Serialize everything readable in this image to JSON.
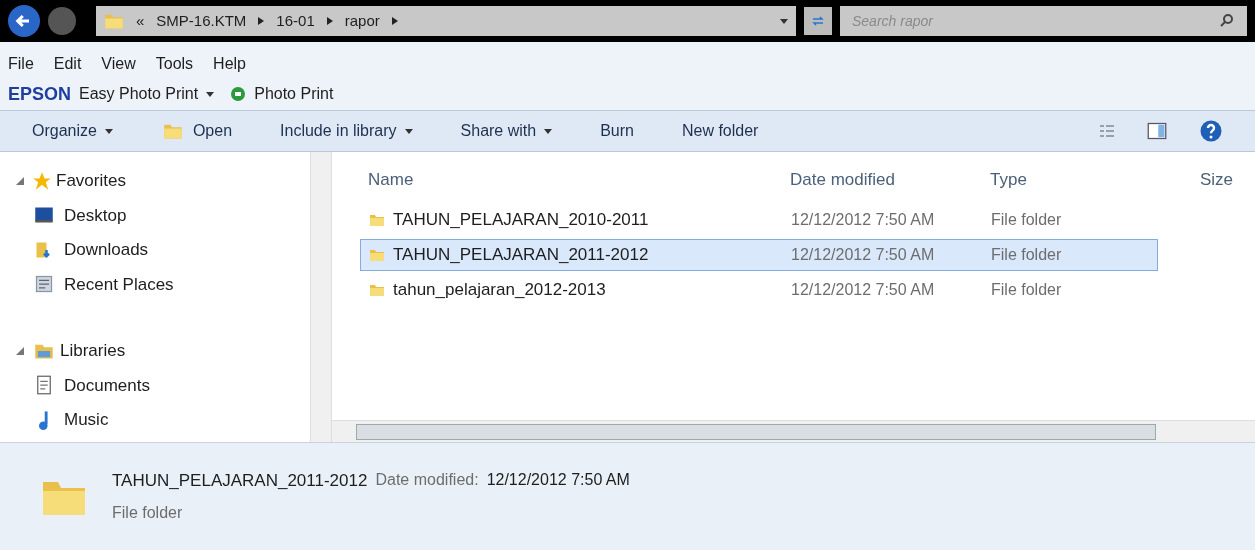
{
  "address_bar": {
    "crumbs": [
      "«",
      "SMP-16.KTM",
      "16-01",
      "rapor"
    ],
    "search_placeholder": "Search rapor"
  },
  "menu": [
    "File",
    "Edit",
    "View",
    "Tools",
    "Help"
  ],
  "epson_bar": {
    "brand": "EPSON",
    "app": "Easy Photo Print",
    "action": "Photo Print"
  },
  "toolbar": [
    {
      "label": "Organize",
      "kind": "dropdown"
    },
    {
      "label": "Open",
      "kind": "open"
    },
    {
      "label": "Include in library",
      "kind": "dropdown"
    },
    {
      "label": "Share with",
      "kind": "dropdown"
    },
    {
      "label": "Burn",
      "kind": "plain"
    },
    {
      "label": "New folder",
      "kind": "plain"
    }
  ],
  "navigation": [
    {
      "label": "Favorites",
      "kind": "star",
      "expanded": true,
      "children": [
        {
          "label": "Desktop",
          "kind": "desktop"
        },
        {
          "label": "Downloads",
          "kind": "downloads"
        },
        {
          "label": "Recent Places",
          "kind": "recent"
        }
      ]
    },
    {
      "label": "Libraries",
      "kind": "library",
      "expanded": true,
      "children": [
        {
          "label": "Documents",
          "kind": "documents"
        },
        {
          "label": "Music",
          "kind": "music"
        }
      ]
    }
  ],
  "table": {
    "columns": [
      "Name",
      "Date modified",
      "Type",
      "Size"
    ],
    "rows": [
      {
        "name": "TAHUN_PELAJARAN_2010-2011",
        "date": "12/12/2012 7:50 AM",
        "type": "File folder",
        "selected": false
      },
      {
        "name": "TAHUN_PELAJARAN_2011-2012",
        "date": "12/12/2012 7:50 AM",
        "type": "File folder",
        "selected": true
      },
      {
        "name": "tahun_pelajaran_2012-2013",
        "date": "12/12/2012 7:50 AM",
        "type": "File folder",
        "selected": false
      }
    ]
  },
  "details": {
    "name": "TAHUN_PELAJARAN_2011-2012",
    "date_label": "Date modified:",
    "date": "12/12/2012 7:50 AM",
    "type": "File folder"
  }
}
